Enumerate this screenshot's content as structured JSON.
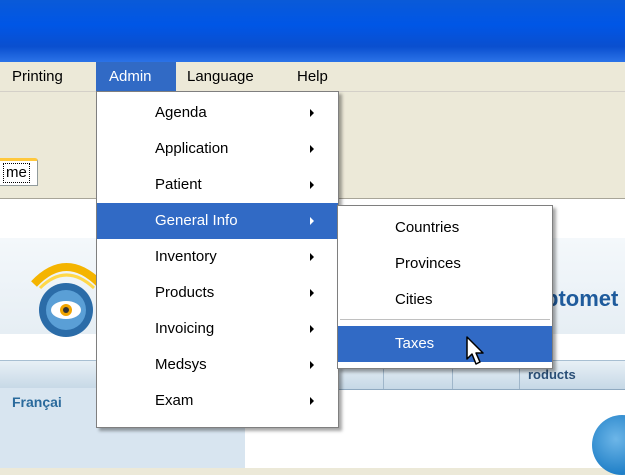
{
  "menubar": {
    "items": [
      {
        "label": "Printing"
      },
      {
        "label": "Admin"
      },
      {
        "label": "Language"
      },
      {
        "label": "Help"
      }
    ]
  },
  "tab": {
    "label": "me"
  },
  "admin_menu": {
    "items": [
      {
        "label": "Agenda"
      },
      {
        "label": "Application"
      },
      {
        "label": "Patient"
      },
      {
        "label": "General Info"
      },
      {
        "label": "Inventory"
      },
      {
        "label": "Products"
      },
      {
        "label": "Invoicing"
      },
      {
        "label": "Medsys"
      },
      {
        "label": "Exam"
      }
    ],
    "highlighted": "General Info"
  },
  "general_info_submenu": {
    "items": [
      {
        "label": "Countries"
      },
      {
        "label": "Provinces"
      },
      {
        "label": "Cities"
      },
      {
        "label": "Taxes"
      }
    ],
    "highlighted": "Taxes"
  },
  "background": {
    "brand_fragment": "ptomet",
    "nav_products": "roducts",
    "language_link": "Françai"
  },
  "colors": {
    "highlight": "#316ac5",
    "titlebar": "#0056e6",
    "menu_bg": "#ece9d8"
  }
}
